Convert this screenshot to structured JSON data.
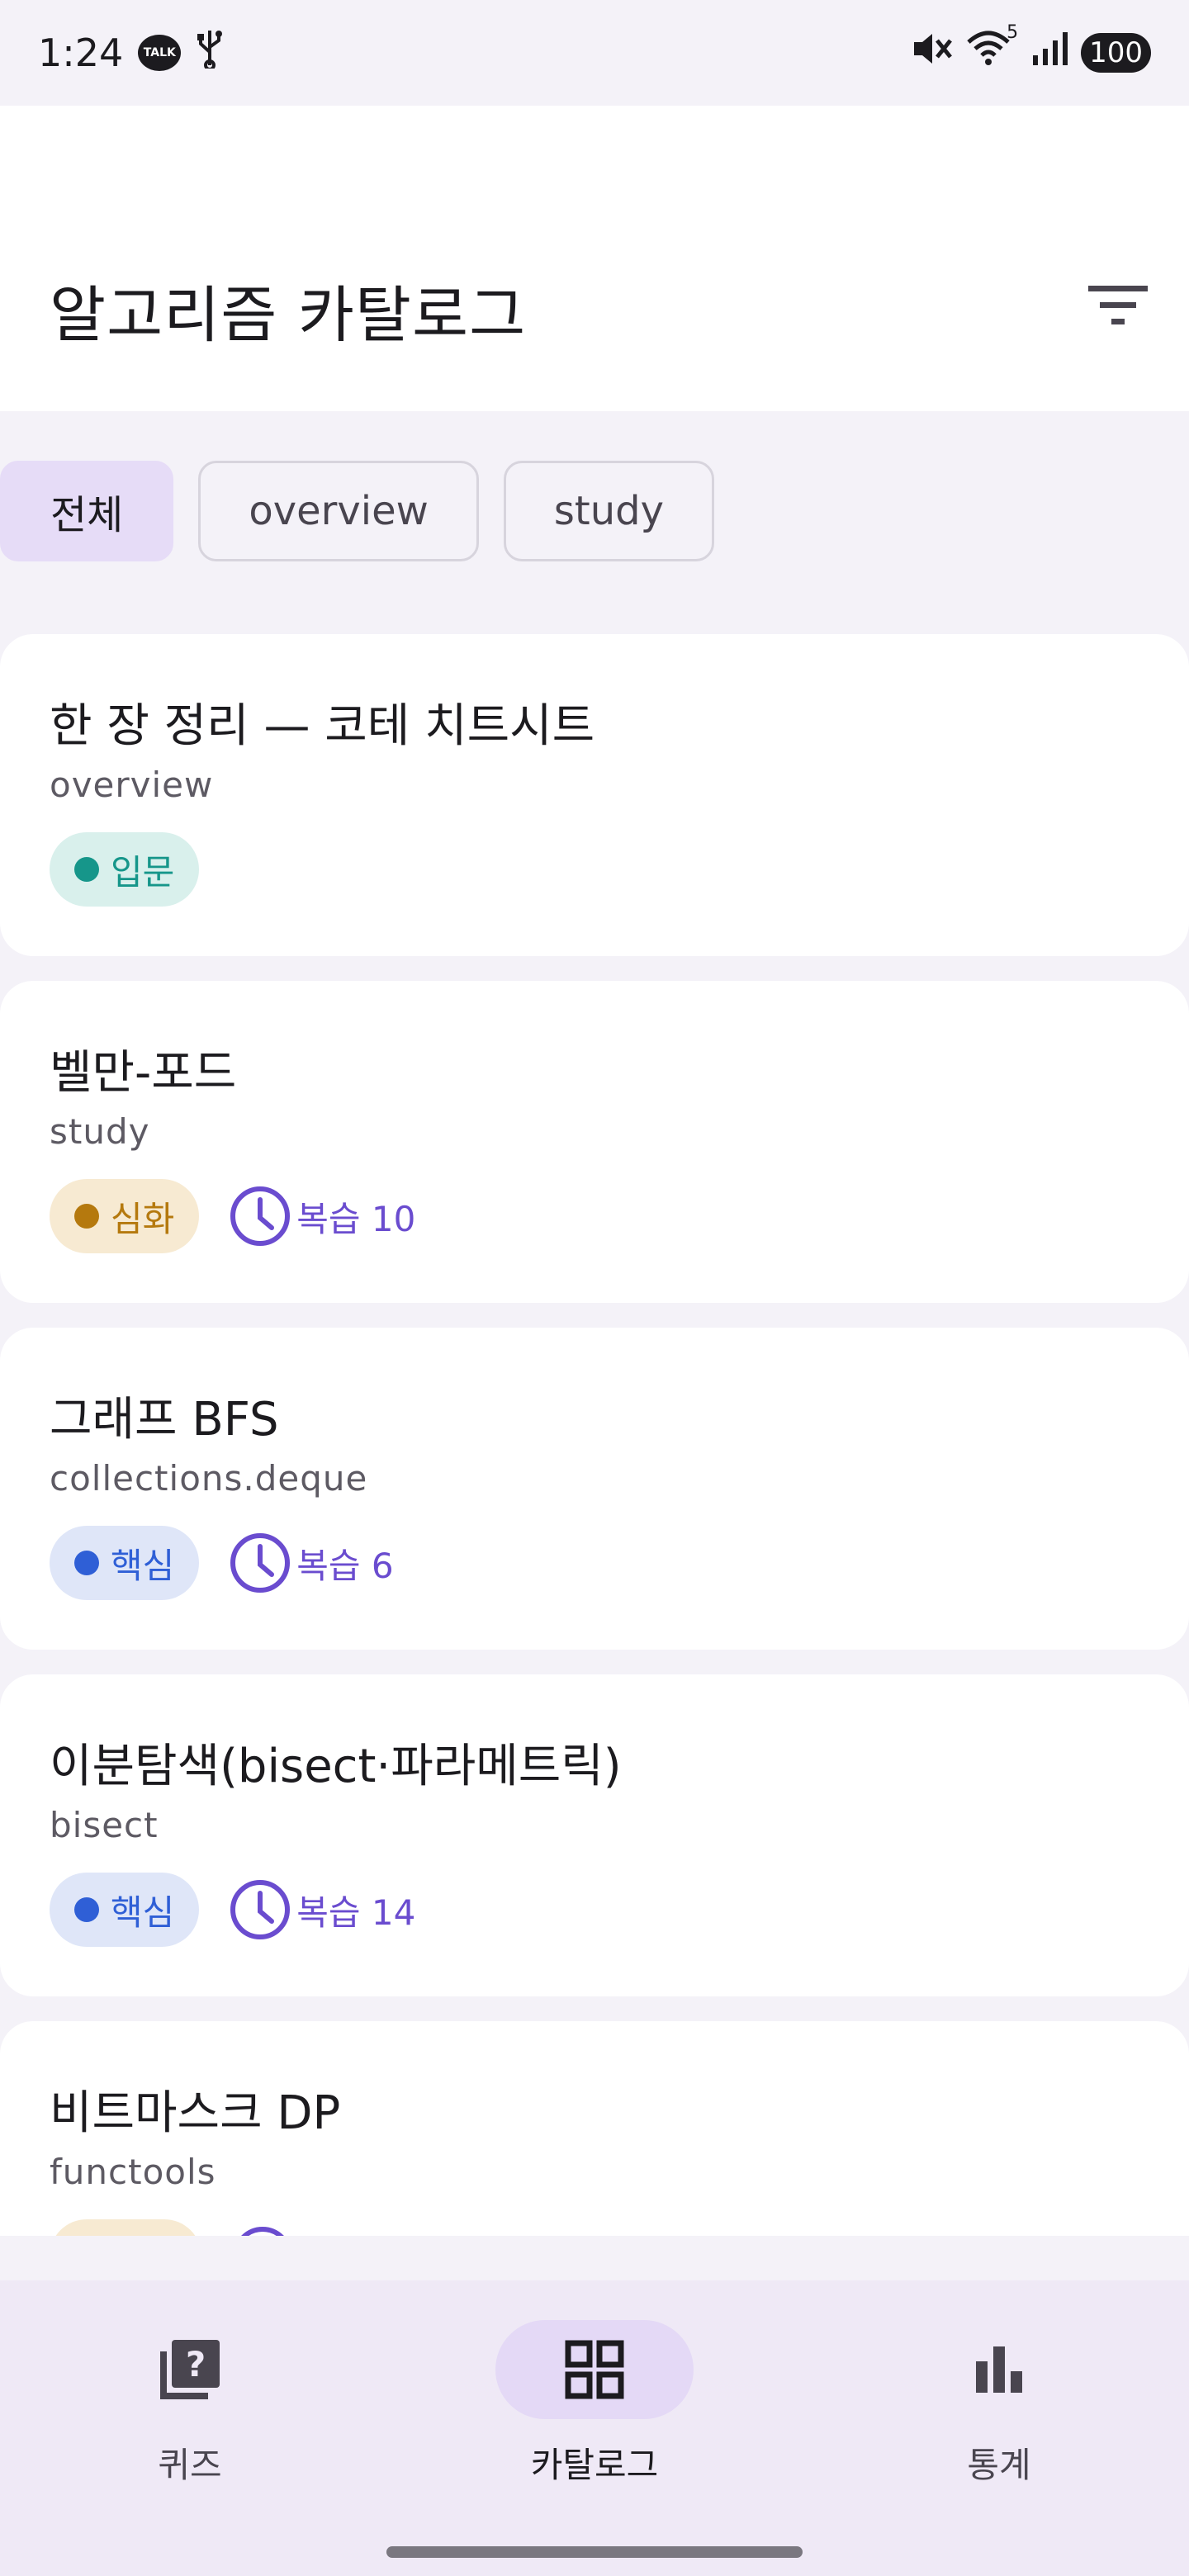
{
  "status_bar": {
    "time": "1:24",
    "talk_badge": "TALK",
    "wifi_label": "5",
    "battery": "100"
  },
  "header": {
    "title": "알고리즘 카탈로그",
    "filter_icon": "filter-list-icon"
  },
  "chips": [
    {
      "label": "전체",
      "selected": true
    },
    {
      "label": "overview",
      "selected": false
    },
    {
      "label": "study",
      "selected": false
    }
  ],
  "cards": [
    {
      "title": "한 장 정리 — 코테 치트시트",
      "subtitle": "overview",
      "level": "입문",
      "level_color": "#16968a",
      "level_bg": "#d9f0ec",
      "review": ""
    },
    {
      "title": "벨만-포드",
      "subtitle": "study",
      "level": "심화",
      "level_color": "#b5790e",
      "level_bg": "#f7ead2",
      "review": "복습 10"
    },
    {
      "title": "그래프 BFS",
      "subtitle": "collections.deque",
      "level": "핵심",
      "level_color": "#2f5fd6",
      "level_bg": "#dfe6f8",
      "review": "복습 6"
    },
    {
      "title": "이분탐색(bisect·파라메트릭)",
      "subtitle": "bisect",
      "level": "핵심",
      "level_color": "#2f5fd6",
      "level_bg": "#dfe6f8",
      "review": "복습 14"
    },
    {
      "title": "비트마스크 DP",
      "subtitle": "functools",
      "level": "",
      "level_color": "#b5790e",
      "level_bg": "#f7ead2",
      "review": ""
    }
  ],
  "bottom_nav": [
    {
      "label": "퀴즈",
      "icon": "quiz-icon",
      "active": false
    },
    {
      "label": "카탈로그",
      "icon": "grid-icon",
      "active": true
    },
    {
      "label": "통계",
      "icon": "bar-chart-icon",
      "active": false
    }
  ],
  "colors": {
    "accent": "#6a4ccf",
    "chip_selected": "#e6dcf7",
    "nav_active": "#e4d9f6"
  }
}
